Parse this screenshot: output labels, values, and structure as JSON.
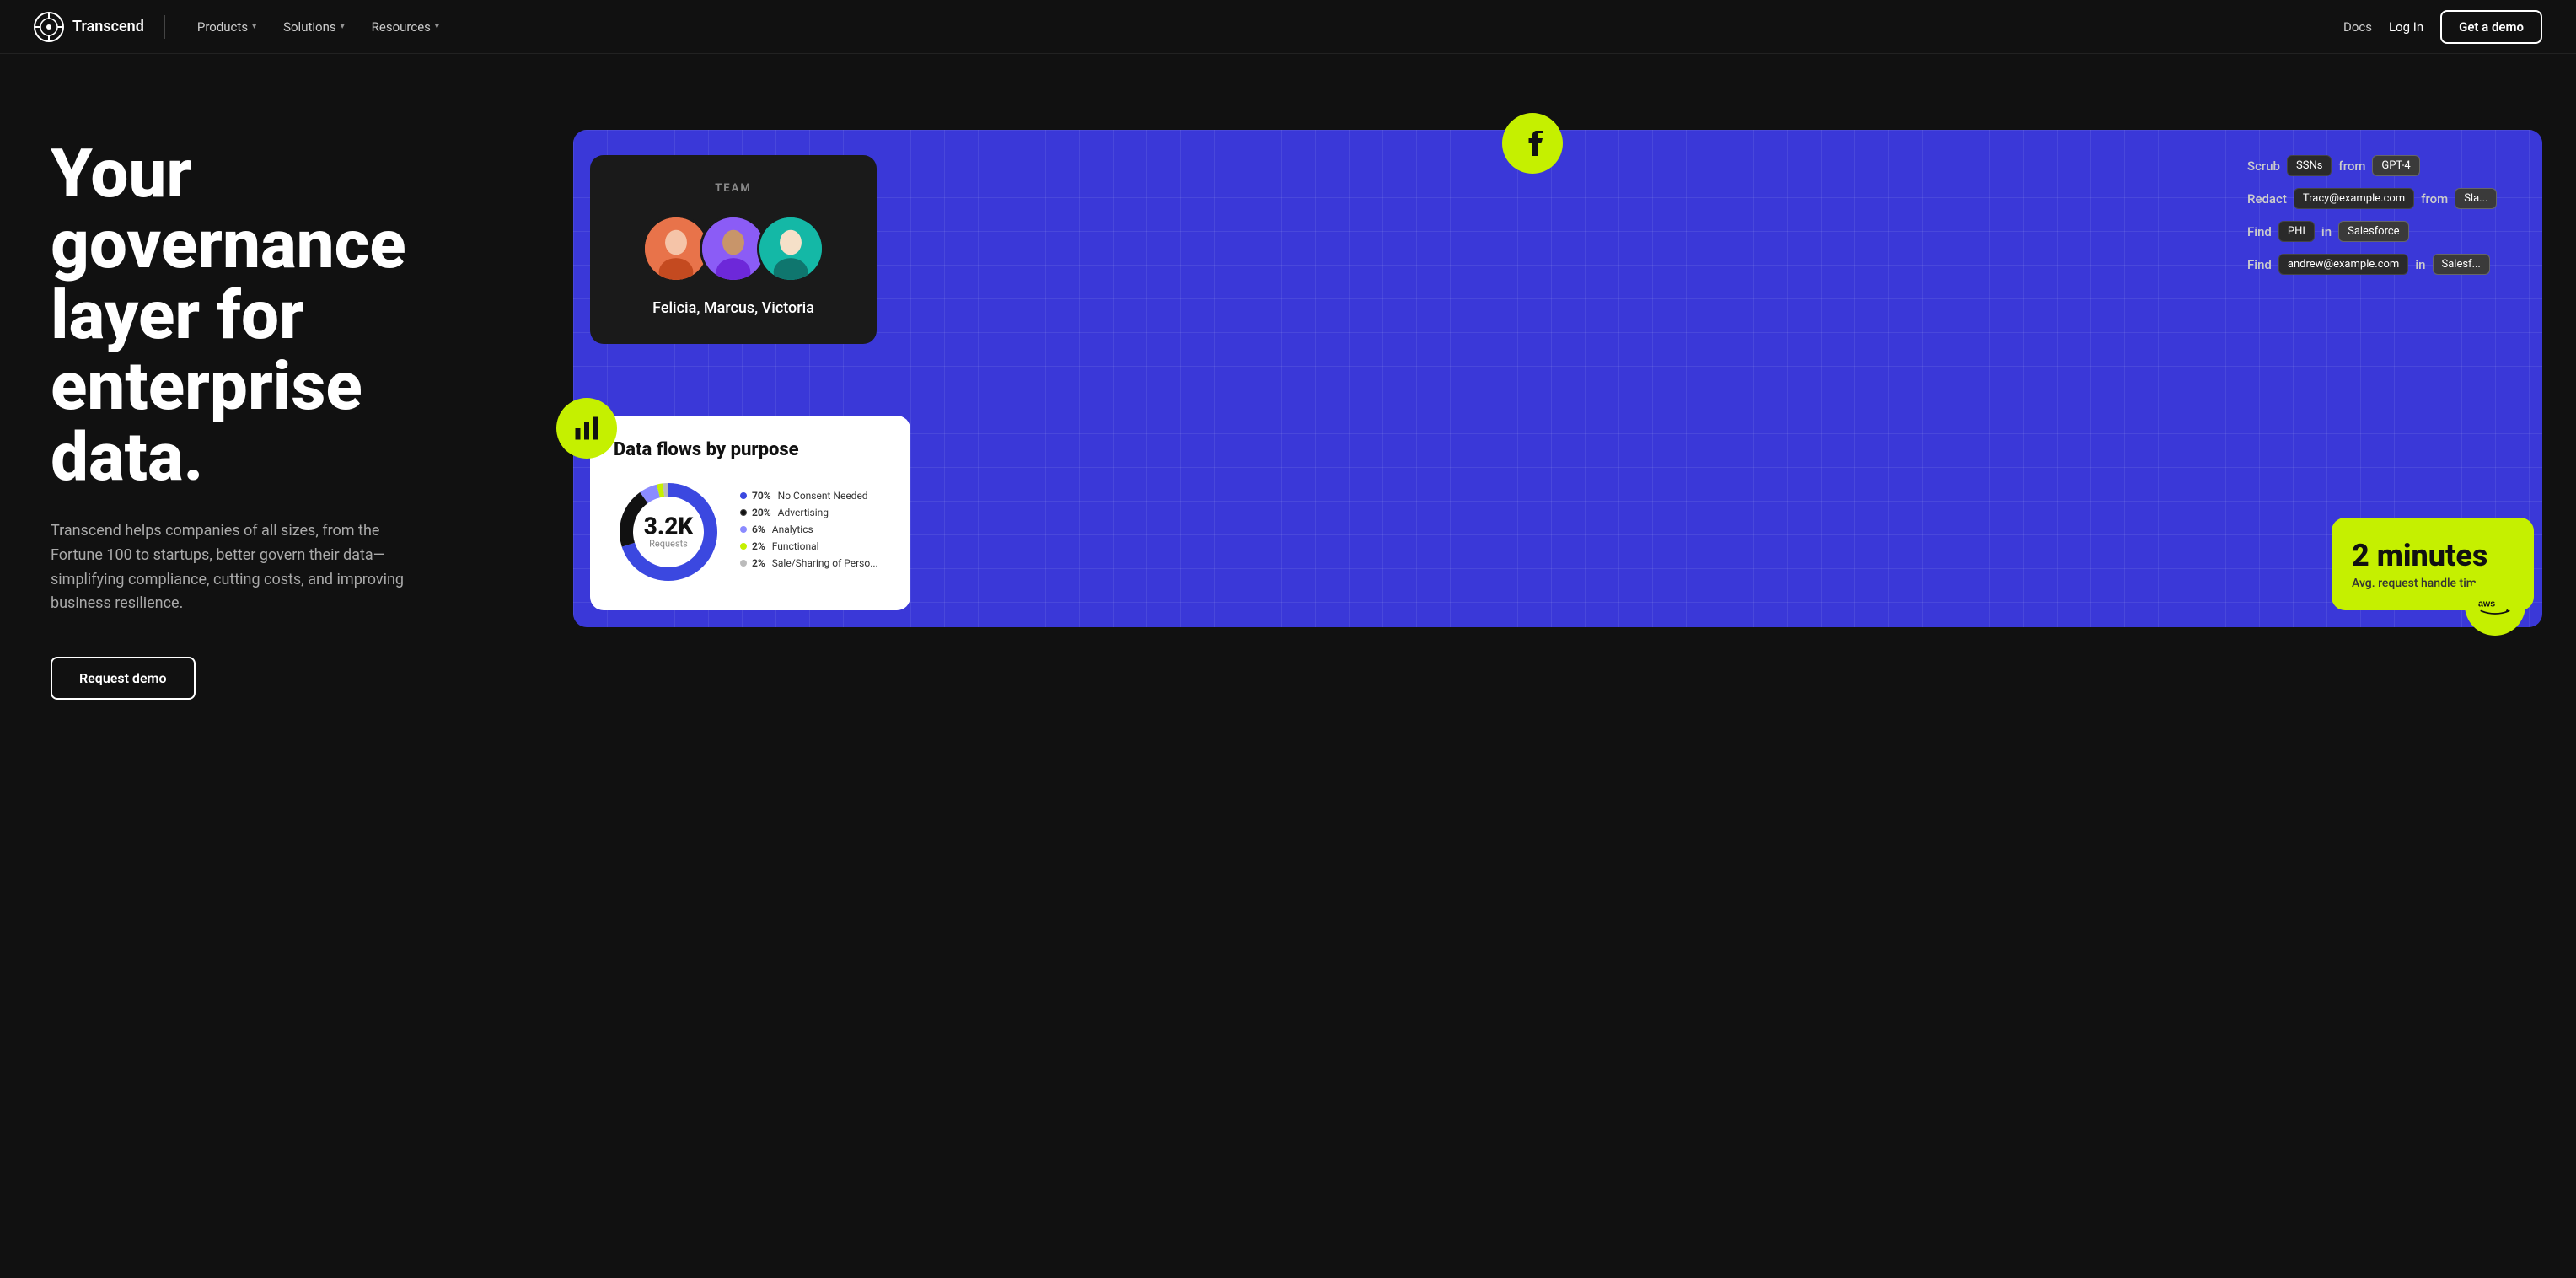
{
  "nav": {
    "logo_text": "Transcend",
    "products_label": "Products",
    "solutions_label": "Solutions",
    "resources_label": "Resources",
    "docs_label": "Docs",
    "login_label": "Log In",
    "cta_label": "Get a demo"
  },
  "hero": {
    "title": "Your governance layer for enterprise data.",
    "subtitle": "Transcend helps companies of all sizes, from the Fortune 100 to startups, better govern their data—simplifying compliance, cutting costs, and improving business resilience.",
    "request_demo_label": "Request demo"
  },
  "team_card": {
    "title": "TEAM",
    "names": "Felicia, Marcus, Victoria"
  },
  "action_rows": [
    {
      "verb": "Scrub",
      "tag1": "SSNs",
      "connector": "from",
      "tag2": "GPT-4"
    },
    {
      "verb": "Redact",
      "tag1": "Tracy@example.com",
      "connector": "from",
      "tag2": "Sla..."
    },
    {
      "verb": "Find",
      "tag1": "PHI",
      "connector": "in",
      "tag2": "Salesforce"
    },
    {
      "verb": "Find",
      "tag1": "andrew@example.com",
      "connector": "in",
      "tag2": "Salesf..."
    }
  ],
  "data_flows": {
    "title": "Data flows by purpose",
    "total": "3.2K",
    "total_label": "Requests",
    "legend": [
      {
        "pct": "70%",
        "label": "No Consent Needed",
        "color": "#3b48e0"
      },
      {
        "pct": "20%",
        "label": "Advertising",
        "color": "#111"
      },
      {
        "pct": "6%",
        "label": "Analytics",
        "color": "#8b8bff"
      },
      {
        "pct": "2%",
        "label": "Functional",
        "color": "#c5f000"
      },
      {
        "pct": "2%",
        "label": "Sale/Sharing of Perso...",
        "color": "#bbb"
      }
    ]
  },
  "two_min": {
    "number": "2 minutes",
    "label": "Avg. request handle time"
  },
  "icons": {
    "fb": "f",
    "aws": "aws",
    "chart": "📊"
  }
}
